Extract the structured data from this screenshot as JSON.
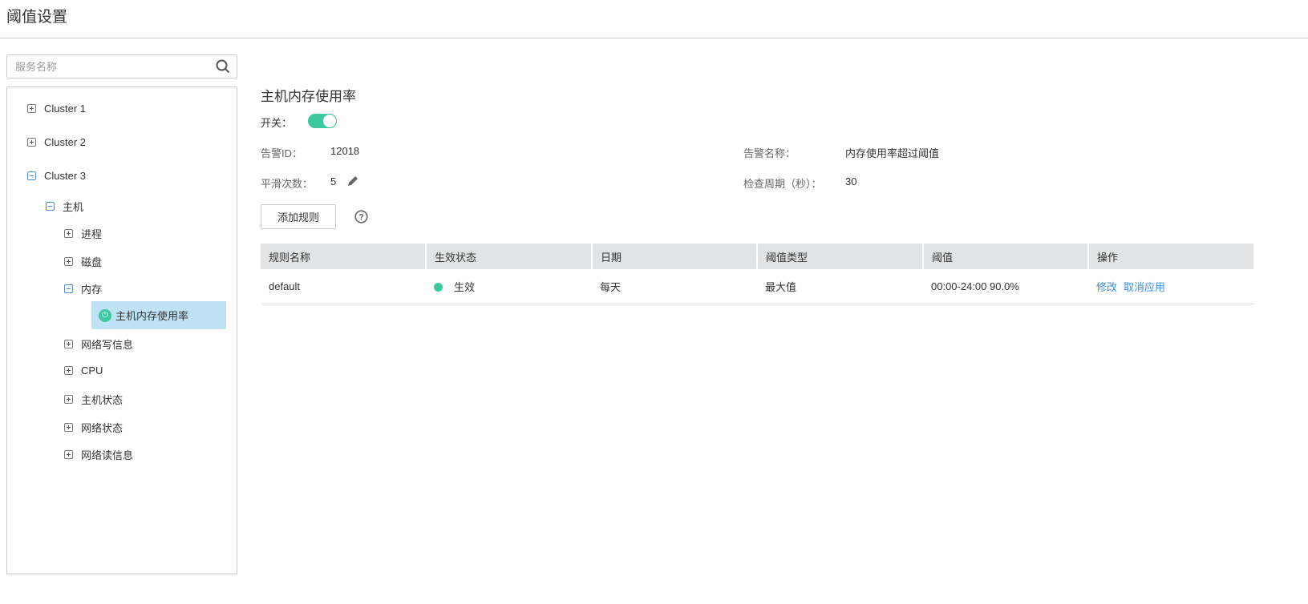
{
  "page_title": "阈值设置",
  "search": {
    "placeholder": "服务名称"
  },
  "tree": {
    "cluster1": "Cluster 1",
    "cluster2": "Cluster 2",
    "cluster3": "Cluster 3",
    "host": "主机",
    "process": "进程",
    "disk": "磁盘",
    "memory": "内存",
    "selected": "主机内存使用率",
    "net_write": "网络写信息",
    "cpu": "CPU",
    "host_status": "主机状态",
    "net_status": "网络状态",
    "net_read": "网络读信息"
  },
  "detail": {
    "title": "主机内存使用率",
    "switch_label": "开关：",
    "switch_on": true,
    "alarm_id_label": "告警ID：",
    "alarm_id": "12018",
    "alarm_name_label": "告警名称：",
    "alarm_name": "内存使用率超过阈值",
    "smooth_label": "平滑次数：",
    "smooth": "5",
    "period_label": "检查周期（秒）：",
    "period": "30",
    "add_rule": "添加规则"
  },
  "table": {
    "headers": [
      "规则名称",
      "生效状态",
      "日期",
      "阈值类型",
      "阈值",
      "操作"
    ],
    "rows": [
      {
        "name": "default",
        "status": "生效",
        "date": "每天",
        "type": "最大值",
        "threshold": "00:00-24:00 90.0%",
        "edit": "修改",
        "cancel": "取消应用"
      }
    ]
  },
  "colors": {
    "accent": "#3cc8a0",
    "link": "#3b8ee8",
    "selected_bg": "#bfe3f4"
  }
}
